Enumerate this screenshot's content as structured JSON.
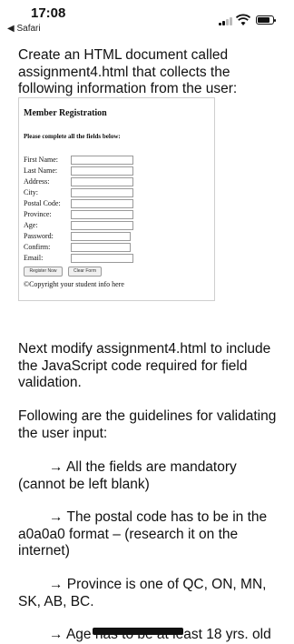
{
  "status_bar": {
    "time": "17:08",
    "back_label": "◀ Safari"
  },
  "intro_text": "Create an HTML document called assignment4.html that collects the following information from the user:",
  "form_screenshot": {
    "title": "Member Registration",
    "subtitle": "Please complete all the fields below:",
    "fields": [
      {
        "label": "First Name:"
      },
      {
        "label": "Last Name:"
      },
      {
        "label": "Address:"
      },
      {
        "label": "City:"
      },
      {
        "label": "Postal Code:"
      },
      {
        "label": "Province:"
      },
      {
        "label": "Age:"
      },
      {
        "label": "Password:"
      },
      {
        "label": "Confirm:"
      },
      {
        "label": "Email:"
      }
    ],
    "buttons": {
      "register": "Register Now",
      "clear": "Clear Form"
    },
    "copyright": "©Copyright your student info here"
  },
  "paragraphs": {
    "modify": "Next modify assignment4.html to include the JavaScript code required for field validation.",
    "guidelines": "Following are the guidelines for validating the user input:",
    "bullet1": "→ All the fields are mandatory (cannot be left blank)",
    "bullet2": "→ The postal code has to be in the a0a0a0 format – (research it on  the internet)",
    "bullet3": "→ Province is one of QC, ON, MN, SK, AB, BC.",
    "bullet4": "→ Age has to be at least 18 yrs. old"
  }
}
